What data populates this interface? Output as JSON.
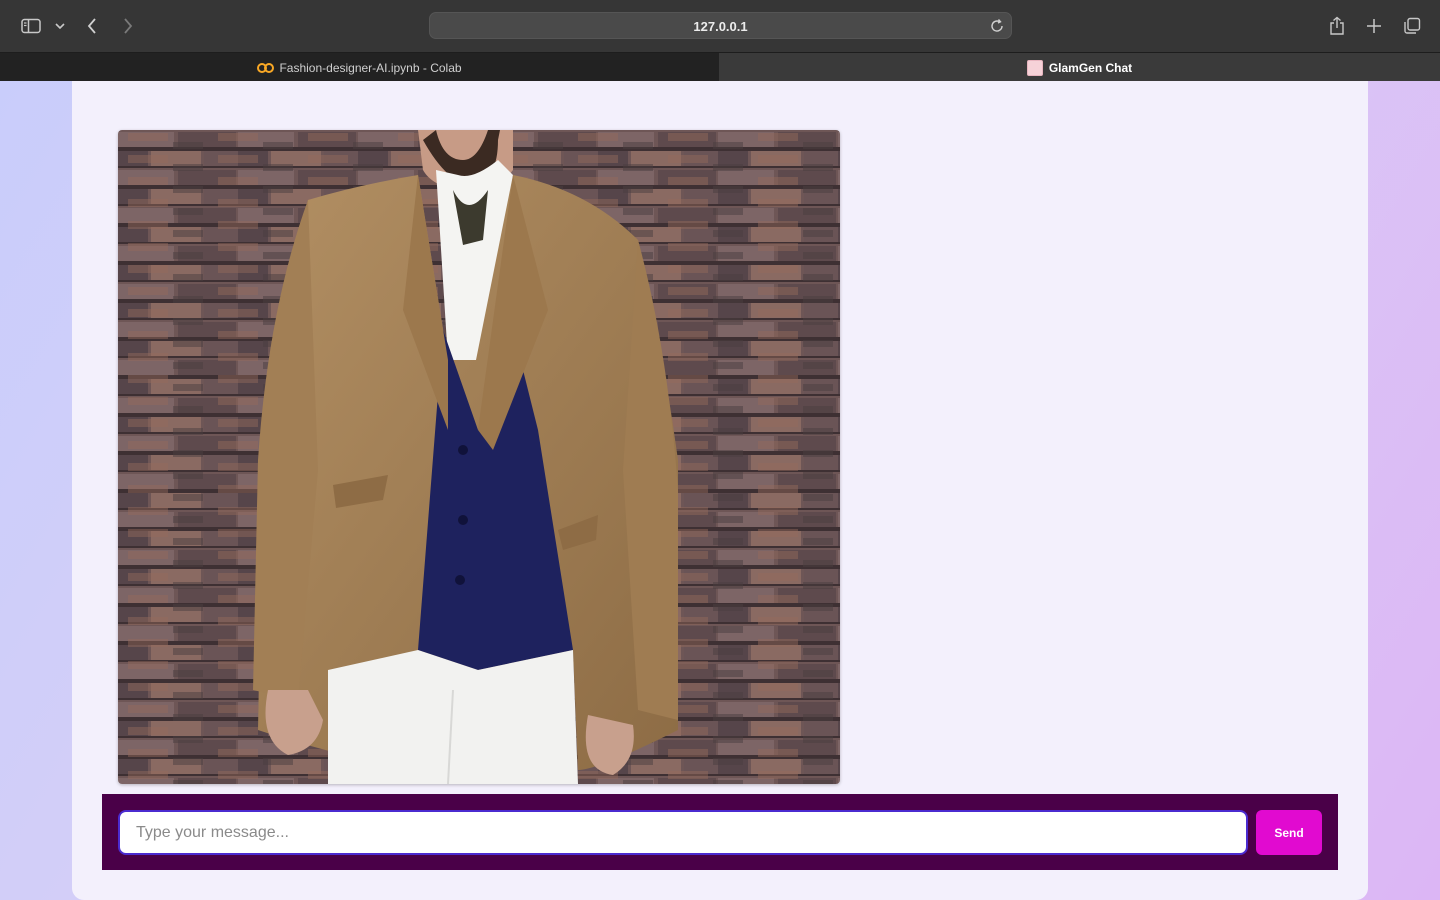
{
  "browser": {
    "url": "127.0.0.1",
    "tabs": [
      {
        "title": "Fashion-designer-AI.ipynb - Colab",
        "active": false,
        "icon": "colab-icon"
      },
      {
        "title": "GlamGen Chat",
        "active": true,
        "icon": "glamgen-favicon"
      }
    ]
  },
  "chat": {
    "generated_image": "man-in-camel-blazer-navy-vest-white-shirt-against-brick-wall",
    "input_value": "",
    "input_placeholder": "Type your message...",
    "send_label": "Send"
  },
  "colors": {
    "composer_bg": "#4a0048",
    "send_button": "#e10ad0",
    "input_border": "#4b2bd0",
    "card_bg": "#f3f0fc"
  }
}
